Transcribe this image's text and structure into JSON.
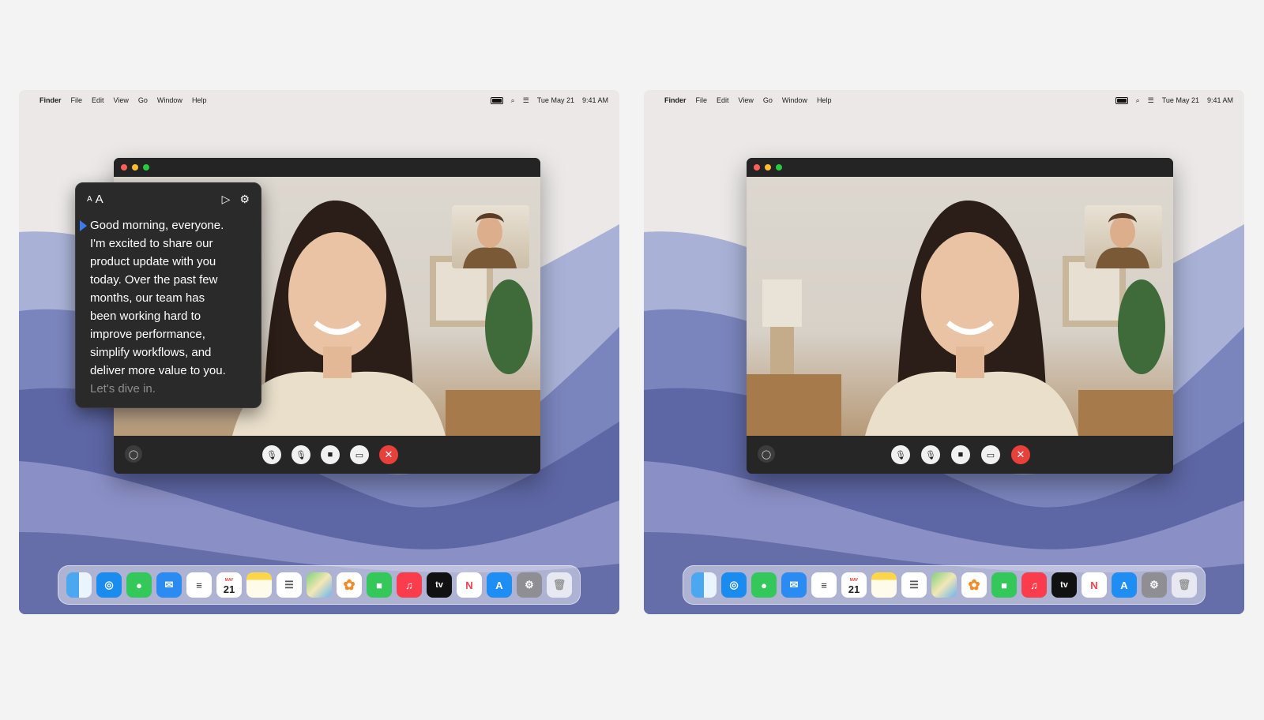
{
  "menubar": {
    "app_name": "Finder",
    "items": [
      "File",
      "Edit",
      "View",
      "Go",
      "Window",
      "Help"
    ],
    "date": "Tue May 21",
    "time": "9:41 AM"
  },
  "teleprompter": {
    "font_small": "A",
    "font_large": "A",
    "lines": [
      "Good morning, everyone.",
      "I'm excited to share our",
      "product update with you",
      "today. Over the past few",
      "months, our team has",
      "been working hard to",
      "improve performance,",
      "simplify workflows, and",
      "deliver more value to you."
    ],
    "upcoming_line": "Let's dive in."
  },
  "calendar_icon": {
    "month": "MAY",
    "day": "21"
  },
  "appletv_label": "tv",
  "colors": {
    "close": "#ff5f57",
    "minimize": "#febc2e",
    "zoom": "#28c840",
    "end_call": "#e8403a",
    "caret": "#3a7bf2"
  },
  "dock_apps": [
    "finder-icon",
    "safari-icon",
    "messages-icon",
    "mail-icon",
    "reminders-icon",
    "calendar-icon",
    "notes-icon",
    "reminders-list-icon",
    "maps-icon",
    "photos-icon",
    "facetime-icon",
    "music-icon",
    "appletv-icon",
    "news-icon",
    "appstore-icon",
    "settings-icon",
    "trash-icon"
  ]
}
